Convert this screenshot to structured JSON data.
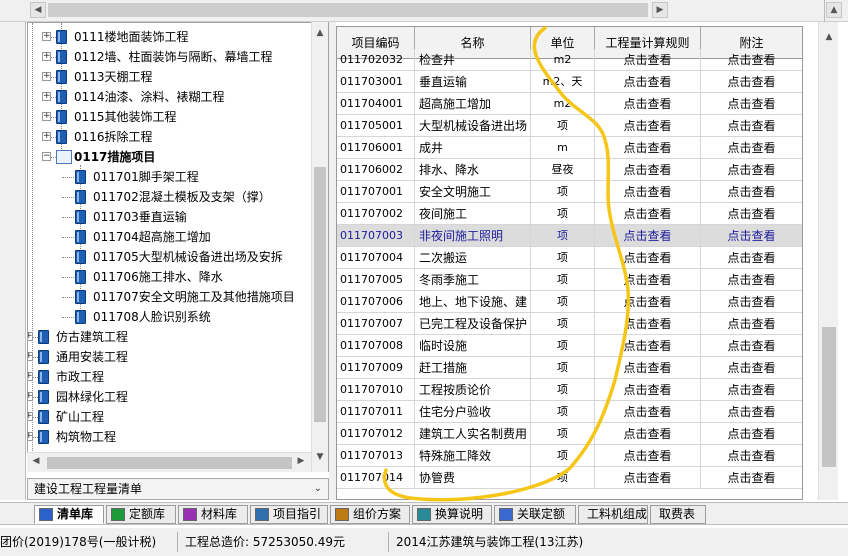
{
  "tree": {
    "items": [
      {
        "label": "0111楼地面装饰工程",
        "expander": "+"
      },
      {
        "label": "0112墙、柱面装饰与隔断、幕墙工程",
        "expander": "+"
      },
      {
        "label": "0113天棚工程",
        "expander": "+"
      },
      {
        "label": "0114油漆、涂料、裱糊工程",
        "expander": "+"
      },
      {
        "label": "0115其他装饰工程",
        "expander": "+"
      },
      {
        "label": "0116拆除工程",
        "expander": "+"
      },
      {
        "label": "0117措施项目",
        "expander": "−"
      },
      {
        "label": "011701脚手架工程"
      },
      {
        "label": "011702混凝土模板及支架（撑）"
      },
      {
        "label": "011703垂直运输"
      },
      {
        "label": "011704超高施工增加"
      },
      {
        "label": "011705大型机械设备进出场及安拆"
      },
      {
        "label": "011706施工排水、降水"
      },
      {
        "label": "011707安全文明施工及其他措施项目"
      },
      {
        "label": "011708人脸识别系统"
      },
      {
        "label": "仿古建筑工程",
        "expander": "+"
      },
      {
        "label": "通用安装工程",
        "expander": "+"
      },
      {
        "label": "市政工程",
        "expander": "+"
      },
      {
        "label": "园林绿化工程",
        "expander": "+"
      },
      {
        "label": "矿山工程",
        "expander": "+"
      },
      {
        "label": "构筑物工程",
        "expander": "+"
      }
    ]
  },
  "dropdown": {
    "value": "建设工程工程量清单"
  },
  "table": {
    "headers": {
      "code": "项目编码",
      "name": "名称",
      "unit": "单位",
      "rule": "工程量计算规则",
      "note": "附注"
    },
    "rows": [
      {
        "code": "011702032",
        "name": "检查井",
        "unit": "m2",
        "rule": "点击查看",
        "note": "点击查看"
      },
      {
        "code": "011703001",
        "name": "垂直运输",
        "unit": "m2、天",
        "rule": "点击查看",
        "note": "点击查看"
      },
      {
        "code": "011704001",
        "name": "超高施工增加",
        "unit": "m2",
        "rule": "点击查看",
        "note": "点击查看"
      },
      {
        "code": "011705001",
        "name": "大型机械设备进出场",
        "unit": "项",
        "rule": "点击查看",
        "note": "点击查看"
      },
      {
        "code": "011706001",
        "name": "成井",
        "unit": "m",
        "rule": "点击查看",
        "note": "点击查看"
      },
      {
        "code": "011706002",
        "name": "排水、降水",
        "unit": "昼夜",
        "rule": "点击查看",
        "note": "点击查看"
      },
      {
        "code": "011707001",
        "name": "安全文明施工",
        "unit": "项",
        "rule": "点击查看",
        "note": "点击查看"
      },
      {
        "code": "011707002",
        "name": "夜间施工",
        "unit": "项",
        "rule": "点击查看",
        "note": "点击查看"
      },
      {
        "code": "011707003",
        "name": "非夜间施工照明",
        "unit": "项",
        "rule": "点击查看",
        "note": "点击查看",
        "selected": true
      },
      {
        "code": "011707004",
        "name": "二次搬运",
        "unit": "项",
        "rule": "点击查看",
        "note": "点击查看"
      },
      {
        "code": "011707005",
        "name": "冬雨季施工",
        "unit": "项",
        "rule": "点击查看",
        "note": "点击查看"
      },
      {
        "code": "011707006",
        "name": "地上、地下设施、建",
        "unit": "项",
        "rule": "点击查看",
        "note": "点击查看"
      },
      {
        "code": "011707007",
        "name": "已完工程及设备保护",
        "unit": "项",
        "rule": "点击查看",
        "note": "点击查看"
      },
      {
        "code": "011707008",
        "name": "临时设施",
        "unit": "项",
        "rule": "点击查看",
        "note": "点击查看"
      },
      {
        "code": "011707009",
        "name": "赶工措施",
        "unit": "项",
        "rule": "点击查看",
        "note": "点击查看"
      },
      {
        "code": "011707010",
        "name": "工程按质论价",
        "unit": "项",
        "rule": "点击查看",
        "note": "点击查看"
      },
      {
        "code": "011707011",
        "name": "住宅分户验收",
        "unit": "项",
        "rule": "点击查看",
        "note": "点击查看"
      },
      {
        "code": "011707012",
        "name": "建筑工人实名制费用",
        "unit": "项",
        "rule": "点击查看",
        "note": "点击查看"
      },
      {
        "code": "011707013",
        "name": "特殊施工降效",
        "unit": "项",
        "rule": "点击查看",
        "note": "点击查看"
      },
      {
        "code": "011707014",
        "name": "协管费",
        "unit": "项",
        "rule": "点击查看",
        "note": "点击查看"
      }
    ]
  },
  "tabs": [
    {
      "label": "清单库",
      "icon": "list-icon",
      "color": "#2a62c9",
      "active": true
    },
    {
      "label": "定额库",
      "icon": "book-icon",
      "color": "#1f9a3a"
    },
    {
      "label": "材料库",
      "icon": "material-icon",
      "color": "#9b2fb4"
    },
    {
      "label": "项目指引",
      "icon": "guide-icon",
      "color": "#2f6fb0"
    },
    {
      "label": "组价方案",
      "icon": "scheme-icon",
      "color": "#c07a14"
    },
    {
      "label": "换算说明",
      "icon": "convert-icon",
      "color": "#2a8a9a"
    },
    {
      "label": "关联定额",
      "icon": "link-icon",
      "color": "#3a6ad0"
    },
    {
      "label": "工料机组成",
      "icon": "",
      "color": ""
    },
    {
      "label": "取费表",
      "icon": "",
      "color": ""
    }
  ],
  "status": {
    "doc": "团价(2019)178号(一般计税)",
    "total": "工程总造价:  57253050.49元",
    "project": "2014江苏建筑与装饰工程(13江苏)"
  },
  "colors": {
    "annotation": "#f5c518",
    "selected_text": "#1c1c9c"
  }
}
